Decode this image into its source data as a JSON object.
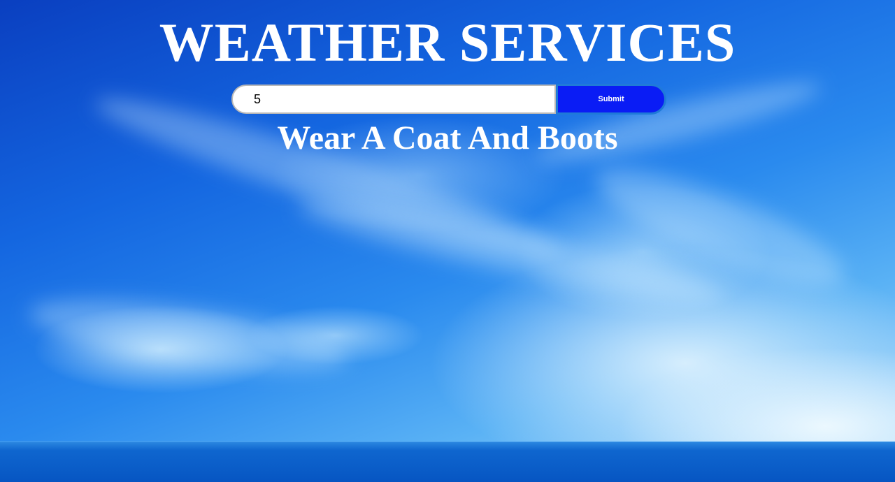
{
  "header": {
    "title": "WEATHER SERVICES"
  },
  "form": {
    "input_value": "5",
    "submit_label": "Submit"
  },
  "result": {
    "advice": "Wear A Coat And Boots"
  },
  "colors": {
    "submit_bg": "#0a1cf5",
    "text": "#ffffff"
  }
}
